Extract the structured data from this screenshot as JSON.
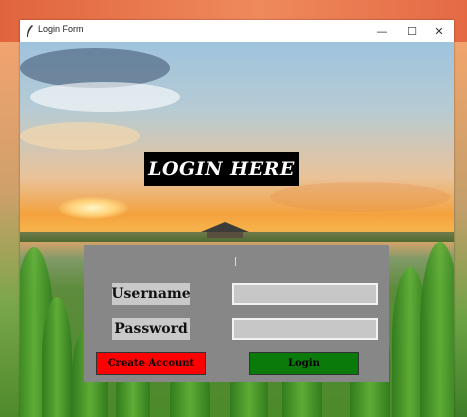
{
  "window": {
    "title": "Login Form",
    "controls": {
      "minimize": "—",
      "maximize": "☐",
      "close": "✕"
    }
  },
  "form": {
    "heading": "LOGIN HERE",
    "username_label": "Username",
    "password_label": "Password",
    "username_value": "",
    "password_value": "",
    "create_account_label": "Create Account",
    "login_label": "Login"
  },
  "colors": {
    "heading_bg": "#000000",
    "panel_bg": "#878787",
    "create_account_bg": "#ff0000",
    "create_account_text": "#000000",
    "login_bg": "#0a7a0a",
    "login_text": "#000000"
  },
  "icons": [
    "feather-icon",
    "minimize-icon",
    "maximize-icon",
    "close-icon"
  ]
}
